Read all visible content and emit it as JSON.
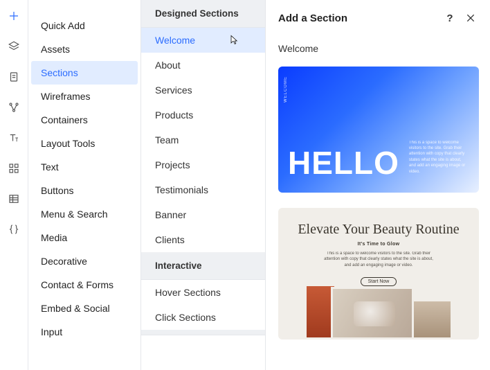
{
  "rail": {
    "icons": [
      "plus-icon",
      "layers-icon",
      "page-icon",
      "nodes-icon",
      "type-icon",
      "grid-icon",
      "table-icon",
      "braces-icon"
    ],
    "active_index": 0
  },
  "primary": {
    "items": [
      "Quick Add",
      "Assets",
      "Sections",
      "Wireframes",
      "Containers",
      "Layout Tools",
      "Text",
      "Buttons",
      "Menu & Search",
      "Media",
      "Decorative",
      "Contact & Forms",
      "Embed & Social",
      "Input"
    ],
    "active_index": 2
  },
  "secondary": {
    "groups": [
      {
        "header": "Designed Sections",
        "items": [
          "Welcome",
          "About",
          "Services",
          "Products",
          "Team",
          "Projects",
          "Testimonials",
          "Banner",
          "Clients"
        ],
        "active_index": 0
      },
      {
        "header": "Interactive",
        "items": [
          "Hover Sections",
          "Click Sections"
        ],
        "active_index": -1
      }
    ]
  },
  "panel": {
    "title": "Add a Section",
    "help_label": "?",
    "section_label": "Welcome"
  },
  "previews": {
    "hello": {
      "headline": "HELLO",
      "vertical": "WELCOME",
      "caption": "This is a space to welcome visitors to the site. Grab their attention with copy that clearly states what the site is about, and add an engaging image or video."
    },
    "beauty": {
      "title": "Elevate Your Beauty Routine",
      "subtitle": "It's Time to Glow",
      "description": "This is a space to welcome visitors to the site. Grab their attention with copy that clearly states what the site is about, and add an engaging image or video.",
      "button": "Start Now"
    }
  }
}
